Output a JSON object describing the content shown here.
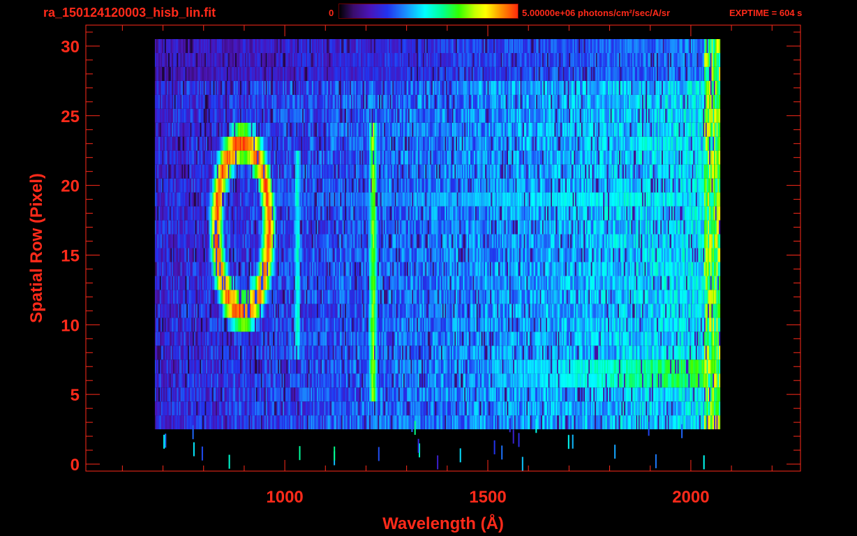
{
  "header": {
    "file_title": "ra_150124120003_hisb_lin.fit",
    "colorbar_min": "0",
    "colorbar_max": "5.00000e+06 photons/cm²/sec/A/sr",
    "exptime": "EXPTIME = 604 s"
  },
  "colors": {
    "axis": "#ff2a1a",
    "background": "#000000"
  },
  "chart_data": {
    "type": "heatmap",
    "title": "ra_150124120003_hisb_lin.fit",
    "xlabel": "Wavelength (Å)",
    "ylabel": "Spatial Row (Pixel)",
    "xlim": [
      510,
      2270
    ],
    "ylim": [
      -0.5,
      31.5
    ],
    "x_ticks": [
      1000,
      1500,
      2000
    ],
    "x_tick_labels": [
      "1000",
      "1500",
      "2000"
    ],
    "y_ticks": [
      0,
      5,
      10,
      15,
      20,
      25,
      30
    ],
    "y_tick_labels": [
      "0",
      "5",
      "10",
      "15",
      "20",
      "25",
      "30"
    ],
    "colorbar": {
      "min": 0,
      "max": 5000000,
      "units": "photons/cm²/sec/A/sr"
    },
    "data_extent": {
      "wavelength_min": 680,
      "wavelength_max": 2070,
      "row_min": 3,
      "row_max": 30
    },
    "features": [
      {
        "type": "ring",
        "wavelength_center": 895,
        "row_center": 17,
        "radius_wavelength": 65,
        "radius_rows": 6,
        "peak_level": 0.95
      },
      {
        "type": "vertical_line",
        "wavelength": 1216,
        "row_min": 5,
        "row_max": 24,
        "peak_level": 0.72
      },
      {
        "type": "vertical_line",
        "wavelength": 1030,
        "row_min": 8,
        "row_max": 22,
        "peak_level": 0.5
      },
      {
        "type": "horizontal_band",
        "row": 6.5,
        "wavelength_min": 1500,
        "wavelength_max": 2070,
        "peak_level": 0.8
      },
      {
        "type": "horizontal_band",
        "row": 19,
        "wavelength_min": 950,
        "wavelength_max": 1900,
        "peak_level": 0.5
      }
    ]
  }
}
